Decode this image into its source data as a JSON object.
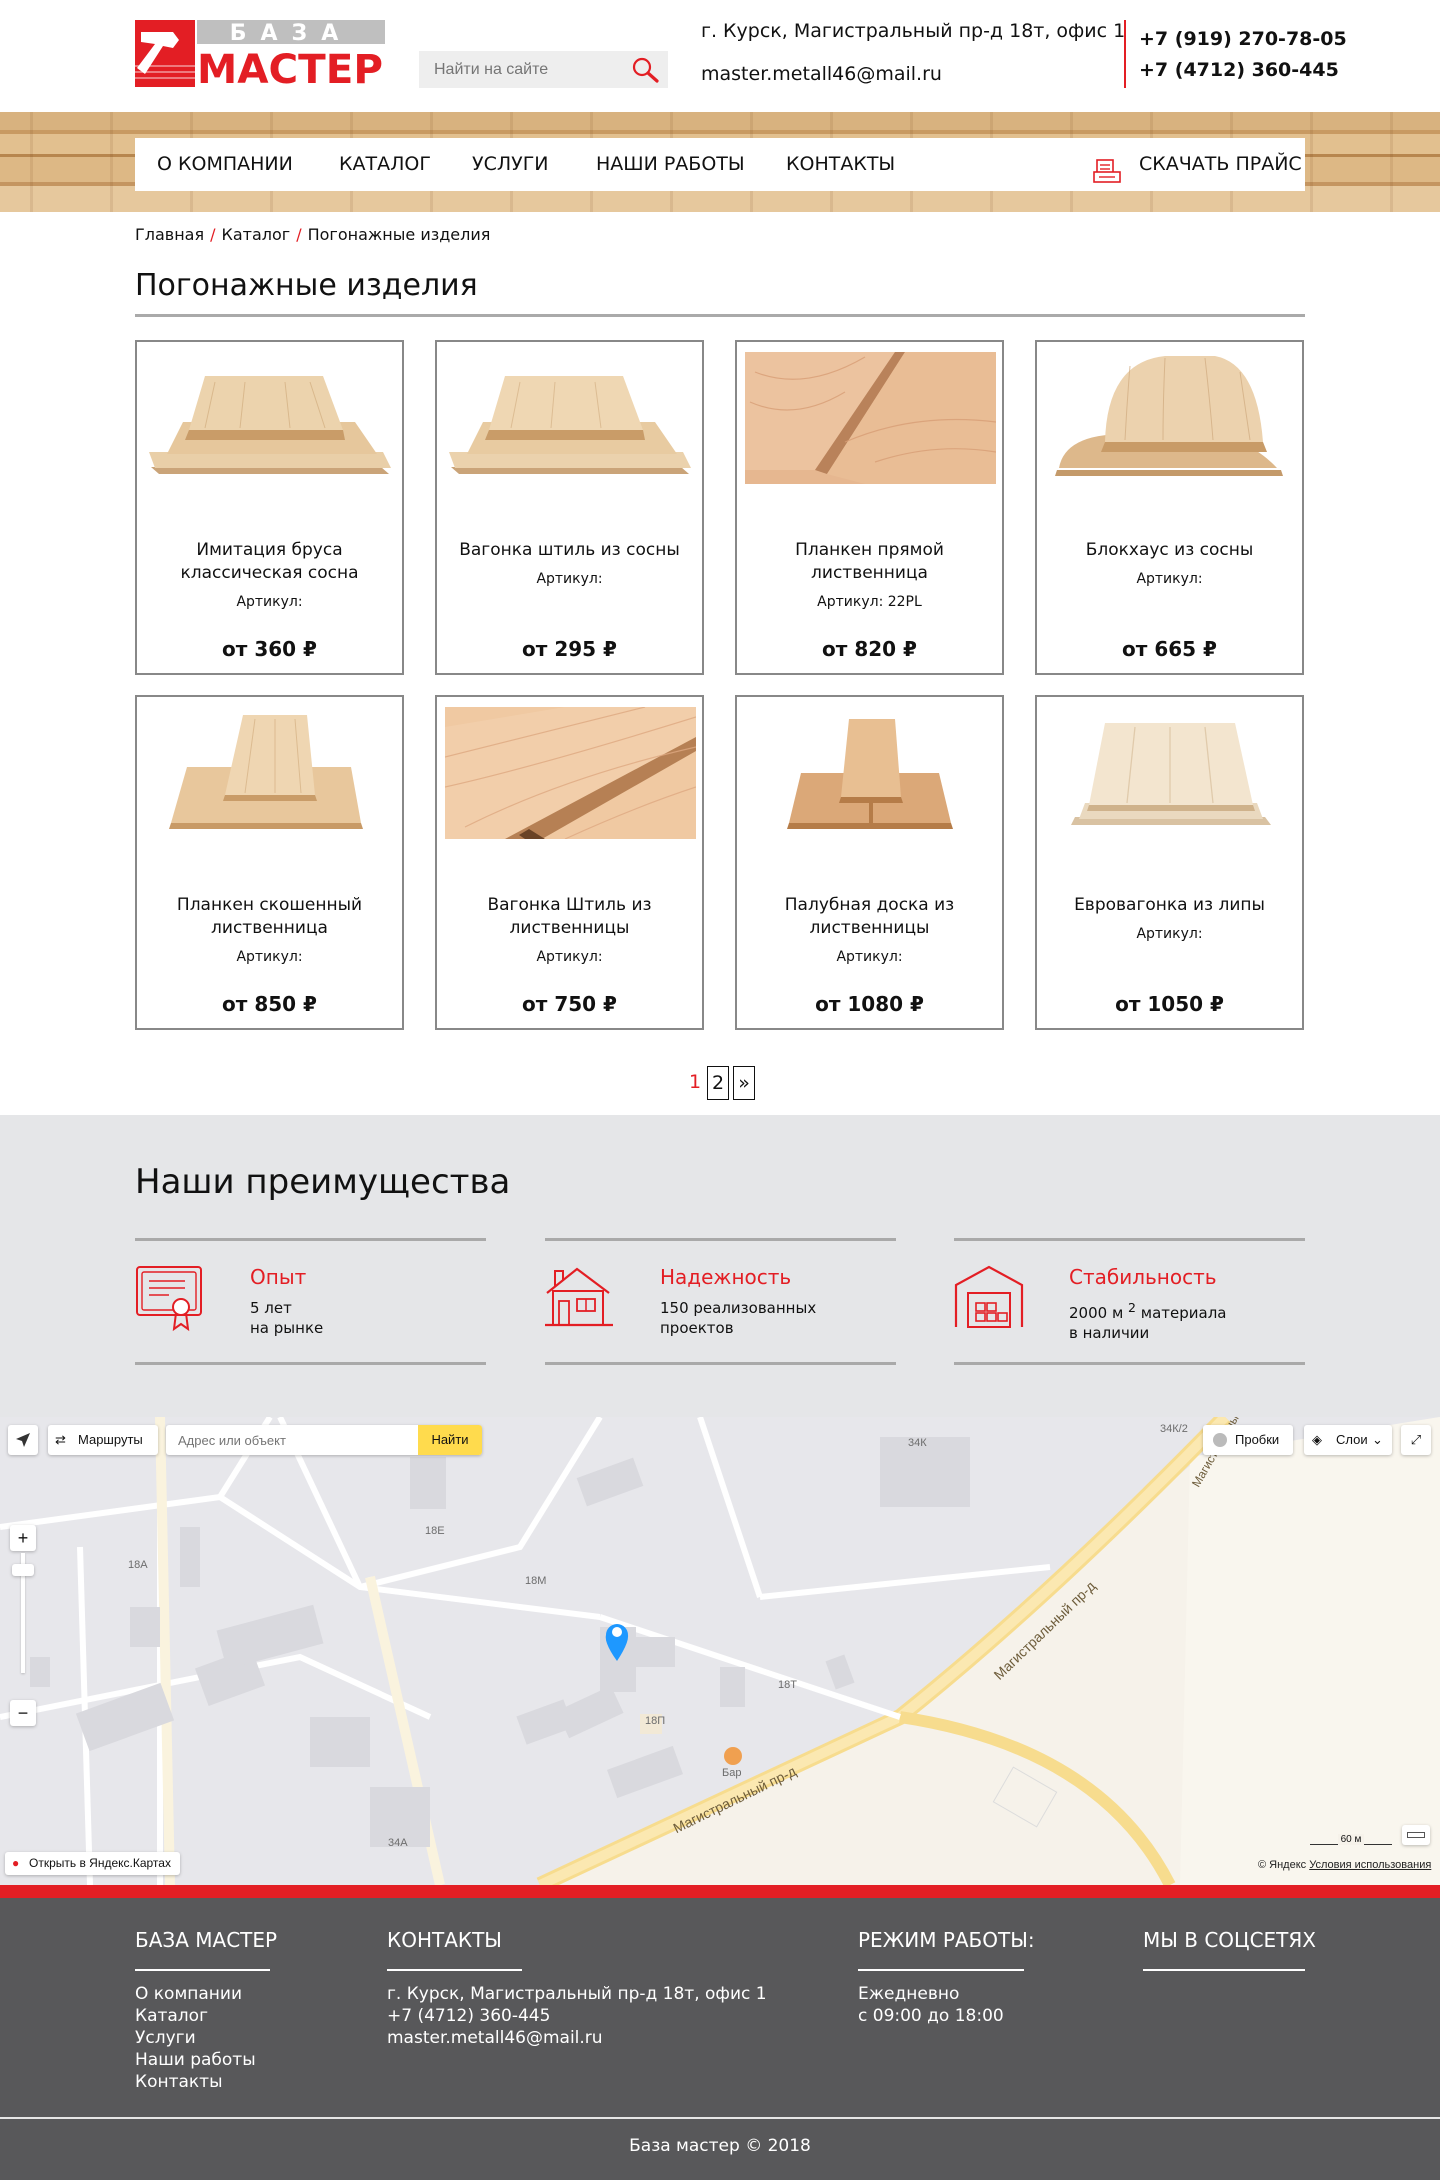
{
  "header": {
    "logo_top": "БАЗА",
    "logo_bottom": "МАСТЕР",
    "search_placeholder": "Найти на сайте",
    "address": "г. Курск, Магистральный пр-д 18т, офис 1",
    "email": "master.metall46@mail.ru",
    "phones": [
      "+7 (919) 270-78-05",
      "+7 (4712) 360-445"
    ]
  },
  "nav": {
    "items": [
      "О КОМПАНИИ",
      "КАТАЛОГ",
      "УСЛУГИ",
      "НАШИ РАБОТЫ",
      "КОНТАКТЫ"
    ],
    "price_label": "СКАЧАТЬ ПРАЙС"
  },
  "breadcrumb": [
    "Главная",
    "Каталог",
    "Погонажные изделия"
  ],
  "page_title": "Погонажные изделия",
  "products": [
    {
      "name": "Имитация бруса классическая сосна",
      "sku": "Артикул:",
      "price": "от 360 ₽"
    },
    {
      "name": "Вагонка штиль из сосны",
      "sku": "Артикул:",
      "price": "от 295 ₽"
    },
    {
      "name": "Планкен прямой лиственница",
      "sku": "Артикул: 22PL",
      "price": "от 820 ₽"
    },
    {
      "name": "Блокхаус из сосны",
      "sku": "Артикул:",
      "price": "от 665 ₽"
    },
    {
      "name": "Планкен скошенный лиственница",
      "sku": "Артикул:",
      "price": "от 850 ₽"
    },
    {
      "name": "Вагонка Штиль из лиственницы",
      "sku": "Артикул:",
      "price": "от 750 ₽"
    },
    {
      "name": "Палубная доска из лиственницы",
      "sku": "Артикул:",
      "price": "от 1080 ₽"
    },
    {
      "name": "Евровагонка из липы",
      "sku": "Артикул:",
      "price": "от 1050 ₽"
    }
  ],
  "pagination": {
    "current": "1",
    "next_page": "2",
    "next": "»"
  },
  "advantages": {
    "title": "Наши преимущества",
    "items": [
      {
        "heading": "Опыт",
        "text": "5 лет\nна рынке",
        "icon": "certificate-icon"
      },
      {
        "heading": "Надежность",
        "text": "150 реализованных\nпроектов",
        "icon": "house-icon"
      },
      {
        "heading": "Стабильность",
        "text_a": "2000 м ",
        "text_sup": "2",
        "text_b": " материала\nв наличии",
        "icon": "warehouse-icon"
      }
    ]
  },
  "map": {
    "routes_label": "Маршруты",
    "search_placeholder": "Адрес или объект",
    "find_label": "Найти",
    "traffic_label": "Пробки",
    "layers_label": "Слои",
    "open_label": "Открыть в Яндекс.Картах",
    "scale_label": "60 м",
    "copyright": "© Яндекс",
    "terms_label": "Условия использования",
    "labels": [
      "34К",
      "34К/2",
      "18Е",
      "18А",
      "18М",
      "18Т",
      "18П",
      "34А",
      "Бар"
    ],
    "street_labels": [
      "Магистральный пр-д",
      "Магистральный пр-д",
      "Магистральный пр-д"
    ]
  },
  "footer": {
    "col1_title": "БАЗА МАСТЕР",
    "col1_links": [
      "О компании",
      "Каталог",
      "Услуги",
      "Наши работы",
      "Контакты"
    ],
    "col2_title": "КОНТАКТЫ",
    "col2_lines": [
      "г. Курск, Магистральный пр-д 18т, офис 1",
      "+7 (4712) 360-445",
      "master.metall46@mail.ru"
    ],
    "col3_title": "РЕЖИМ РАБОТЫ:",
    "col3_lines": [
      "Ежедневно",
      "с 09:00 до 18:00"
    ],
    "col4_title": "МЫ В СОЦСЕТЯХ",
    "copyright": "База мастер © 2018"
  },
  "colors": {
    "accent": "#e31e24",
    "footer_bg": "#58585a",
    "advantages_bg": "#e5e6e8"
  }
}
